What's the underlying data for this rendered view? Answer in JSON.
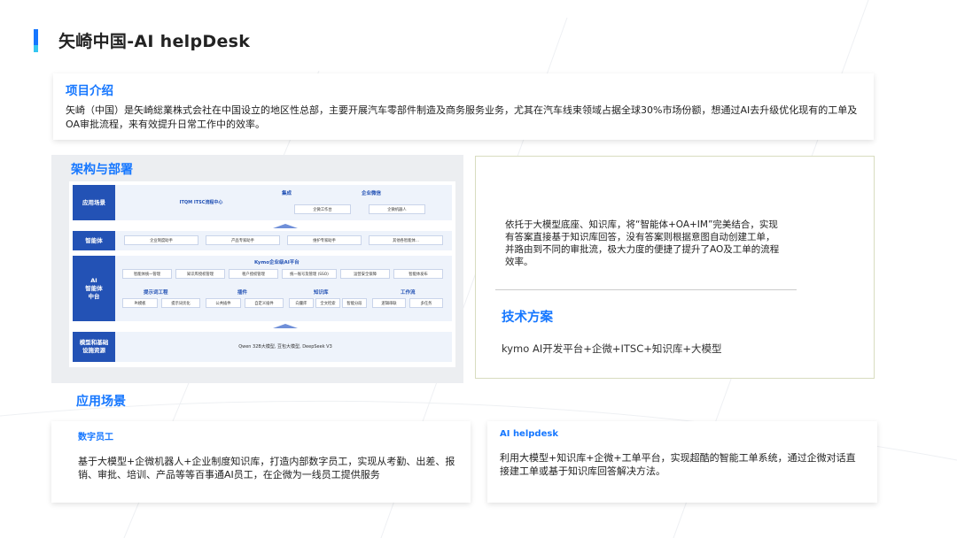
{
  "page": {
    "title": "矢崎中国-AI helpDesk"
  },
  "intro": {
    "heading": "项目介绍",
    "body": "矢崎（中国）是矢崎総業株式会社在中国设立的地区性总部，主要开展汽车零部件制造及商务服务业务，尤其在汽车线束领域占据全球30%市场份额，想通过AI去升级优化现有的工单及OA审批流程，来有效提升日常工作中的效率。"
  },
  "architecture": {
    "heading": "架构与部署",
    "rows": {
      "scene": {
        "label": "应用场景",
        "main": "ITQM ITSC流程中心",
        "group1": "集成",
        "group2": "企业微信",
        "pill1": "企微工作台",
        "pill2": "企微机器人"
      },
      "agent": {
        "label": "智能体",
        "pills": [
          "企业制度助手",
          "产品专家助手",
          "维护专家助手",
          "其他各智能体..."
        ]
      },
      "platform": {
        "label": "AI\n智能体\n中台",
        "title": "Kymo企业级AI平台",
        "top_pills": [
          "智能体统一管理",
          "知识库授权管理",
          "租户授权管理",
          "统一账号及管理 (SSO)",
          "运营安全保障",
          "智能体发布"
        ],
        "groups": [
          "提示词工程",
          "插件",
          "知识库",
          "工作流"
        ],
        "bottom_pills": [
          "Pt模板",
          "提示词优化",
          "公共插件",
          "自定义插件",
          "向量库",
          "全文检索",
          "智能分段",
          "逻辑串联",
          "多任务"
        ]
      },
      "infra": {
        "label": "模型和基础\n设施资源",
        "main": "Qwen 32B大模型, 豆包大模型, DeepSeek V3"
      }
    }
  },
  "deployment": {
    "body": "依托于大模型底座、知识库，将“智能体+OA+IM”完美结合，实现有答案直接基于知识库回答，没有答案则根据意图自动创建工单，并路由到不同的审批流，极大力度的便捷了提升了AO及工单的流程效率。",
    "tech_heading": "技术方案",
    "tech_body": "kymo AI开发平台+企微+ITSC+知识库+大模型"
  },
  "scenarios": {
    "heading": "应用场景",
    "items": [
      {
        "title": "数字员工",
        "body": "基于大模型+企微机器人+企业制度知识库，打造内部数字员工，实现从考勤、出差、报销、审批、培训、产品等等百事通AI员工，在企微为一线员工提供服务"
      },
      {
        "title": "AI helpdesk",
        "body": "利用大模型+知识库+企微+工单平台，实现超酷的智能工单系统，通过企微对话直接建工单或基于知识库回答解决方法。"
      }
    ]
  },
  "colors": {
    "accent": "#1677ff",
    "diagram_label": "#2352b5"
  }
}
